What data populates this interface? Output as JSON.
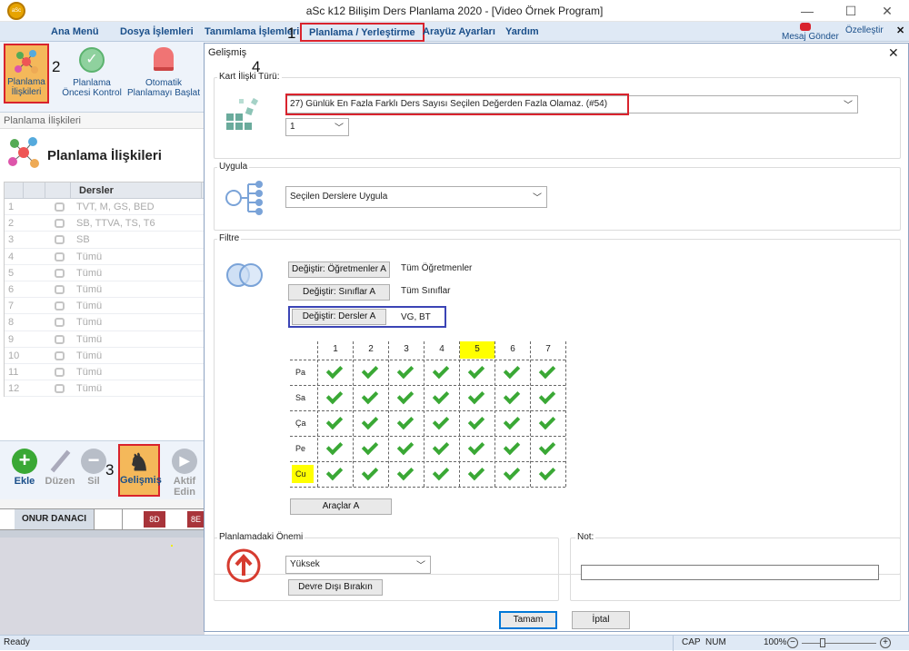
{
  "app": {
    "title": "aSc k12 Bilişim Ders Planlama 2020  - [Video Örnek Program]",
    "logo_text": "aSc"
  },
  "window": {
    "minimize": "—",
    "maximize": "☐",
    "close": "✕"
  },
  "menu": {
    "items": [
      "Ana Menü",
      "Dosya İşlemleri",
      "Tanımlama İşlemleri",
      "Planlama / Yerleştirme",
      "Arayüz Ayarları",
      "Yardım"
    ],
    "send_message": "Mesaj Gönder",
    "customize": "Özelleştir",
    "close_x": "✕"
  },
  "ribbon": {
    "buttons": [
      {
        "line1": "Planlama",
        "line2": "İlişkileri"
      },
      {
        "line1": "Planlama",
        "line2": "Öncesi Kontrol"
      },
      {
        "line1": "Otomatik",
        "line2": "Planlamayı Başlat"
      }
    ]
  },
  "left_panel": {
    "header": "Planlama İlişkileri",
    "title": "Planlama İlişkileri",
    "column": "Dersler",
    "rows": [
      {
        "n": "1",
        "t": "TVT, M, GS, BED"
      },
      {
        "n": "2",
        "t": "SB, TTVA, TS, T6"
      },
      {
        "n": "3",
        "t": "SB"
      },
      {
        "n": "4",
        "t": "Tümü"
      },
      {
        "n": "5",
        "t": "Tümü"
      },
      {
        "n": "6",
        "t": "Tümü"
      },
      {
        "n": "7",
        "t": "Tümü"
      },
      {
        "n": "8",
        "t": "Tümü"
      },
      {
        "n": "9",
        "t": "Tümü"
      },
      {
        "n": "10",
        "t": "Tümü"
      },
      {
        "n": "11",
        "t": "Tümü"
      },
      {
        "n": "12",
        "t": "Tümü"
      }
    ],
    "tools": [
      {
        "label": "Ekle",
        "line2": ""
      },
      {
        "label": "Düzen",
        "line2": ""
      },
      {
        "label": "Sil",
        "line2": ""
      },
      {
        "label": "Gelişmiş",
        "line2": ""
      },
      {
        "label": "Aktif",
        "line2": "Edin"
      }
    ],
    "teacher_name": "ONUR DANACI",
    "cell1": "8D",
    "cell2": "8E"
  },
  "callouts": {
    "one": "1",
    "two": "2",
    "three": "3",
    "four": "4"
  },
  "dialog": {
    "title": "Gelişmiş",
    "close": "✕",
    "card_type_label": "Kart İlişki Türü:",
    "card_type_value": "27) Günlük En Fazla Farklı Ders Sayısı Seçilen Değerden Fazla Olamaz. (#54)",
    "count_value": "1",
    "apply_label": "Uygula",
    "apply_value": "Seçilen Derslere Uygula",
    "filter_label": "Filtre",
    "filters": [
      {
        "button": "Değiştir: Öğretmenler A",
        "value": "Tüm Öğretmenler"
      },
      {
        "button": "Değiştir: Sınıflar A",
        "value": "Tüm Sınıflar"
      },
      {
        "button": "Değiştir: Dersler A",
        "value": "VG, BT"
      }
    ],
    "periods": [
      "1",
      "2",
      "3",
      "4",
      "5",
      "6",
      "7"
    ],
    "days": [
      "Pa",
      "Sa",
      "Ça",
      "Pe",
      "Cu"
    ],
    "tools_button": "Araçlar A",
    "importance_label": "Planlamadaki Önemi",
    "importance_value": "Yüksek",
    "disable_button": "Devre Dışı Bırakın",
    "note_label": "Not:",
    "note_value": "",
    "ok": "Tamam",
    "cancel": "İptal"
  },
  "status": {
    "ready": "Ready",
    "cap": "CAP",
    "num": "NUM",
    "zoom": "100%"
  },
  "colors": {
    "highlight_yellow": "#ffff00",
    "check_green": "#3aa835",
    "red_box": "#d9232d",
    "green_box": "#2e9e3e",
    "blue_box": "#3b44b5"
  }
}
